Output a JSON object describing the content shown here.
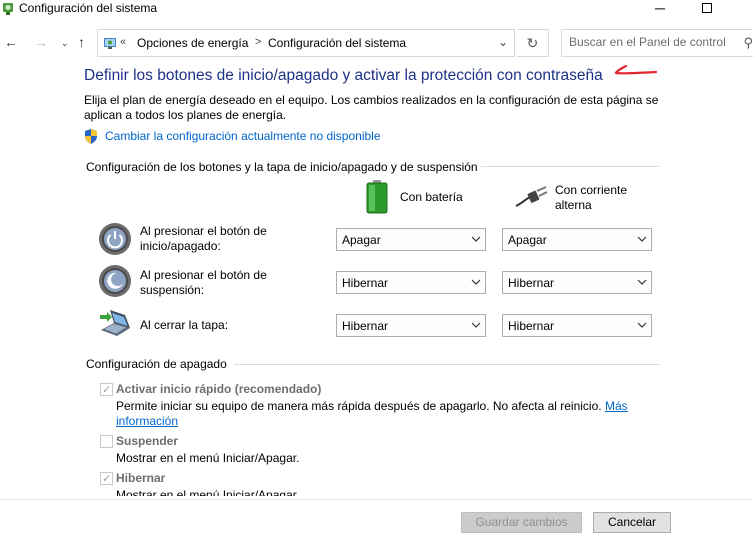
{
  "window": {
    "title": "Configuración del sistema",
    "minimize": "─"
  },
  "navigation": {
    "back": "←",
    "forward": "→",
    "history_dropdown": "⌄",
    "up": "↑",
    "breadcrumb_separator": "«",
    "breadcrumb_arrow": ">",
    "breadcrumbs": [
      "Opciones de energía",
      "Configuración del sistema"
    ],
    "address_dropdown": "⌄",
    "refresh": "↻",
    "search_placeholder": "Buscar en el Panel de control",
    "search_icon": "⚲"
  },
  "content": {
    "title": "Definir los botones de inicio/apagado y activar la protección con contraseña",
    "description": "Elija el plan de energía deseado en el equipo. Los cambios realizados en la configuración de esta página se aplican a todos los planes de energía.",
    "change_settings_link": "Cambiar la configuración actualmente no disponible",
    "buttons_section": {
      "header": "Configuración de los botones y la tapa de inicio/apagado y de suspensión",
      "col_battery": "Con batería",
      "col_ac": "Con corriente alterna",
      "rows": [
        {
          "label": "Al presionar el botón de inicio/apagado:",
          "battery": "Apagar",
          "ac": "Apagar"
        },
        {
          "label": "Al presionar el botón de suspensión:",
          "battery": "Hibernar",
          "ac": "Hibernar"
        },
        {
          "label": "Al cerrar la tapa:",
          "battery": "Hibernar",
          "ac": "Hibernar"
        }
      ]
    },
    "shutdown_section": {
      "header": "Configuración de apagado",
      "options": [
        {
          "label": "Activar inicio rápido (recomendado)",
          "checked": true,
          "description": "Permite iniciar su equipo de manera más rápida después de apagarlo. No afecta al reinicio.",
          "more_link": "Más información"
        },
        {
          "label": "Suspender",
          "checked": false,
          "description": "Mostrar en el menú Iniciar/Apagar."
        },
        {
          "label": "Hibernar",
          "checked": true,
          "description": "Mostrar en el menú Iniciar/Apagar."
        }
      ]
    }
  },
  "footer": {
    "save": "Guardar cambios",
    "cancel": "Cancelar"
  },
  "checkmark": "✓",
  "colors": {
    "title_blue": "#1e3287",
    "link_blue": "#0066cc",
    "annotation_red": "#e0282e"
  }
}
